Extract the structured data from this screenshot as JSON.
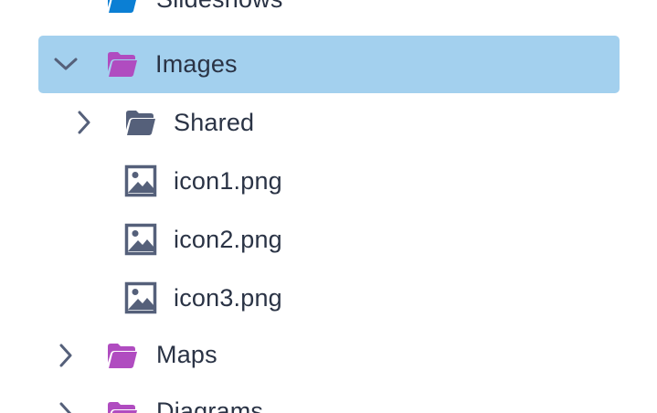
{
  "tree": {
    "items": [
      {
        "label": "Slideshows",
        "icon": "folder-open-icon",
        "color": "#0b7fd4",
        "expanded": false
      },
      {
        "label": "Images",
        "icon": "folder-open-icon",
        "color": "#b04cc0",
        "expanded": true,
        "selected": true
      },
      {
        "label": "Shared",
        "icon": "folder-open-icon",
        "color": "#55607a",
        "expanded": false
      },
      {
        "label": "icon1.png",
        "icon": "image-file-icon",
        "color": "#55607a"
      },
      {
        "label": "icon2.png",
        "icon": "image-file-icon",
        "color": "#55607a"
      },
      {
        "label": "icon3.png",
        "icon": "image-file-icon",
        "color": "#55607a"
      },
      {
        "label": "Maps",
        "icon": "folder-open-icon",
        "color": "#b04cc0",
        "expanded": false
      },
      {
        "label": "Diagrams",
        "icon": "folder-open-icon",
        "color": "#b04cc0",
        "expanded": false
      }
    ],
    "colors": {
      "selection": "#a3d0ee",
      "text": "#2a3345",
      "chevron": "#55607a"
    }
  }
}
